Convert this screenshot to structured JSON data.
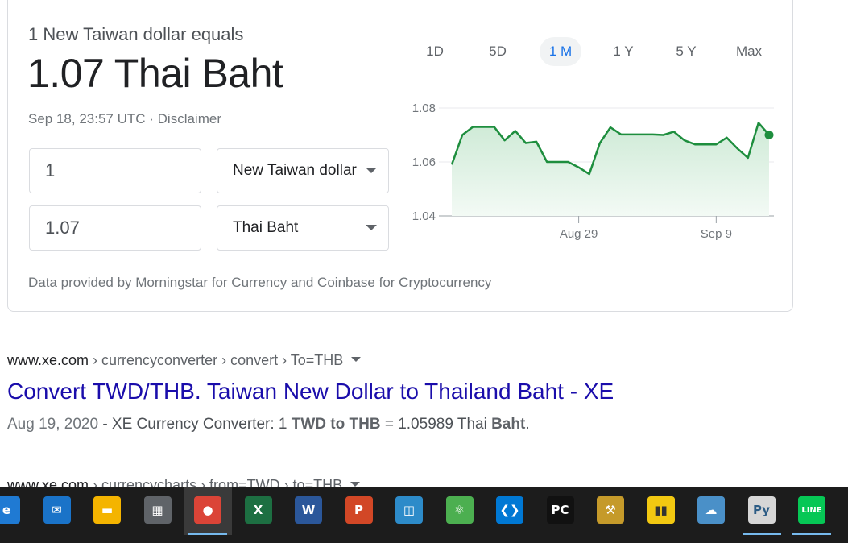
{
  "converter": {
    "equals_label": "1 New Taiwan dollar equals",
    "rate_text": "1.07 Thai Baht",
    "timestamp": "Sep 18, 23:57 UTC",
    "separator": " · ",
    "disclaimer": "Disclaimer",
    "from_amount": "1",
    "from_currency": "New Taiwan dollar",
    "to_amount": "1.07",
    "to_currency": "Thai Baht",
    "provider_note": "Data provided by Morningstar for Currency and Coinbase for Cryptocurrency"
  },
  "range_tabs": [
    {
      "label": "1D",
      "active": false
    },
    {
      "label": "5D",
      "active": false
    },
    {
      "label": "1 M",
      "active": true
    },
    {
      "label": "1 Y",
      "active": false
    },
    {
      "label": "5 Y",
      "active": false
    },
    {
      "label": "Max",
      "active": false
    }
  ],
  "chart_data": {
    "type": "area",
    "ylim": [
      1.04,
      1.08
    ],
    "yticks": [
      "1.04",
      "1.06",
      "1.08"
    ],
    "xticks": [
      {
        "label": "Aug 29",
        "index": 12
      },
      {
        "label": "Sep 9",
        "index": 25
      }
    ],
    "values": [
      1.059,
      1.07,
      1.073,
      1.073,
      1.073,
      1.068,
      1.0715,
      1.067,
      1.0675,
      1.06,
      1.06,
      1.06,
      1.058,
      1.0555,
      1.067,
      1.0728,
      1.0702,
      1.0702,
      1.0702,
      1.0702,
      1.07,
      1.0712,
      1.068,
      1.0665,
      1.0665,
      1.0665,
      1.069,
      1.065,
      1.0615,
      1.0745,
      1.07
    ],
    "line_color": "#1e8e3e",
    "fill_color": "#e6f4ea"
  },
  "results": [
    {
      "site": "www.xe.com",
      "crumbs": " › currencyconverter › convert › To=THB",
      "title": "Convert TWD/THB. Taiwan New Dollar to Thailand Baht - XE",
      "snippet_date": "Aug 19, 2020",
      "snippet_pre": " - XE Currency Converter: 1 ",
      "snippet_bold1": "TWD to THB",
      "snippet_mid": " = 1.05989 Thai ",
      "snippet_bold2": "Baht",
      "snippet_end": "."
    },
    {
      "site": "www.xe.com",
      "crumbs": " › currencycharts › from=TWD › to=THB"
    }
  ],
  "taskbar": {
    "apps": [
      {
        "name": "edge-icon",
        "label": "e",
        "color": "#1f7ad3",
        "active": false,
        "open": false
      },
      {
        "name": "mail-icon",
        "label": "✉",
        "color": "#1a73c8",
        "active": false,
        "open": false
      },
      {
        "name": "file-explorer-icon",
        "label": "▬",
        "color": "#f4b400",
        "active": false,
        "open": false
      },
      {
        "name": "calculator-icon",
        "label": "▦",
        "color": "#5f6368",
        "active": false,
        "open": false
      },
      {
        "name": "chrome-icon",
        "label": "●",
        "color": "#db4437",
        "active": true,
        "open": true
      },
      {
        "name": "excel-icon",
        "label": "X",
        "color": "#1d6f42",
        "active": false,
        "open": false
      },
      {
        "name": "word-icon",
        "label": "W",
        "color": "#2b579a",
        "active": false,
        "open": false
      },
      {
        "name": "powerpoint-icon",
        "label": "P",
        "color": "#d24726",
        "active": false,
        "open": false
      },
      {
        "name": "container-app-icon",
        "label": "◫",
        "color": "#2d8bc9",
        "active": false,
        "open": false
      },
      {
        "name": "atom-icon",
        "label": "⚛",
        "color": "#4caf50",
        "active": false,
        "open": false
      },
      {
        "name": "vscode-icon",
        "label": "❮❯",
        "color": "#0078d4",
        "active": false,
        "open": false
      },
      {
        "name": "pycharm-icon",
        "label": "PC",
        "color": "#111111",
        "active": false,
        "open": false
      },
      {
        "name": "database-tools-icon",
        "label": "⚒",
        "color": "#c59a2a",
        "active": false,
        "open": false
      },
      {
        "name": "power-bi-icon",
        "label": "▮▮",
        "color": "#f2c811",
        "active": false,
        "open": false
      },
      {
        "name": "cloud-gear-icon",
        "label": "☁",
        "color": "#4a90c8",
        "active": false,
        "open": false
      },
      {
        "name": "python-file-icon",
        "label": "Py",
        "color": "#d6d6d6",
        "active": false,
        "open": true
      },
      {
        "name": "line-icon",
        "label": "LINE",
        "color": "#06c755",
        "active": false,
        "open": true
      },
      {
        "name": "photos-icon",
        "label": "▲",
        "color": "#1f7ad3",
        "active": false,
        "open": false
      }
    ]
  }
}
